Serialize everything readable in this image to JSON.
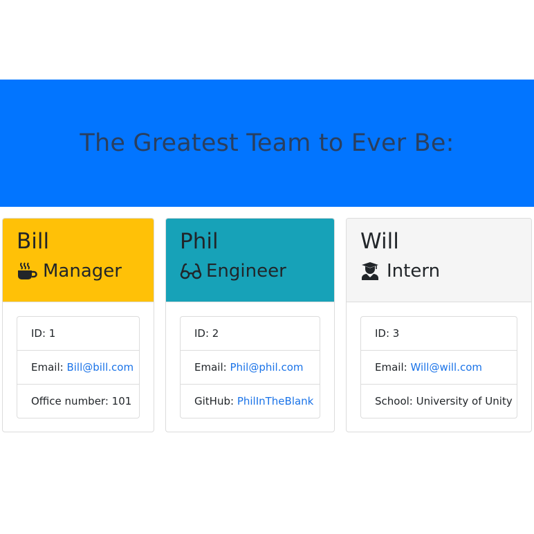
{
  "header": {
    "title": "The Greatest Team to Ever Be:"
  },
  "colors": {
    "jumbotron": "#0275ff",
    "manager": "#ffc107",
    "engineer": "#17a2b8",
    "intern": "#f5f5f5",
    "link": "#1a73e8"
  },
  "team": [
    {
      "name": "Bill",
      "role": "Manager",
      "icon": "coffee-icon",
      "id_text": "ID: 1",
      "email_prefix": "Email: ",
      "email": "Bill@bill.com",
      "extra_prefix": "Office number: ",
      "extra_value": "101"
    },
    {
      "name": "Phil",
      "role": "Engineer",
      "icon": "glasses-icon",
      "id_text": "ID: 2",
      "email_prefix": "Email: ",
      "email": "Phil@phil.com",
      "extra_prefix": "GitHub: ",
      "extra_value": "PhilInTheBlank"
    },
    {
      "name": "Will",
      "role": "Intern",
      "icon": "graduate-icon",
      "id_text": "ID: 3",
      "email_prefix": "Email: ",
      "email": "Will@will.com",
      "extra_prefix": "School: ",
      "extra_value": "University of Unity"
    }
  ]
}
